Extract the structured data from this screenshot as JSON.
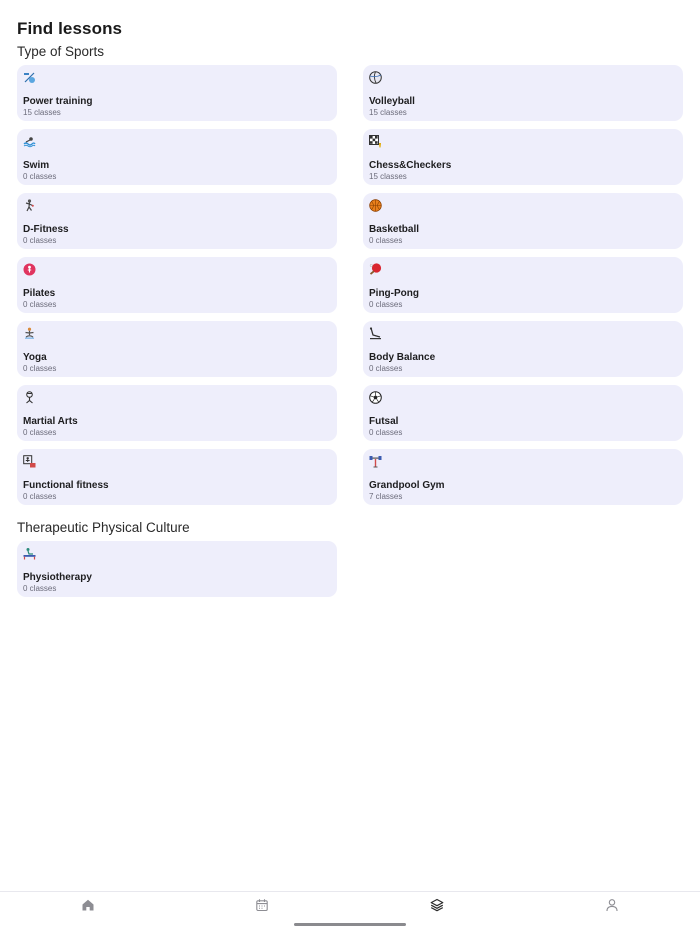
{
  "header": {
    "title": "Find lessons"
  },
  "sections": [
    {
      "title": "Type of Sports"
    },
    {
      "title": "Therapeutic Physical Culture"
    }
  ],
  "sports": [
    {
      "name": "Power training",
      "classes": "15 classes",
      "icon": "dumbbell-ball-icon"
    },
    {
      "name": "Volleyball",
      "classes": "15 classes",
      "icon": "volleyball-icon"
    },
    {
      "name": "Swim",
      "classes": "0 classes",
      "icon": "swimmer-icon"
    },
    {
      "name": "Chess&Checkers",
      "classes": "15 classes",
      "icon": "chess-board-icon"
    },
    {
      "name": "D-Fitness",
      "classes": "0 classes",
      "icon": "dancer-icon"
    },
    {
      "name": "Basketball",
      "classes": "0 classes",
      "icon": "basketball-icon"
    },
    {
      "name": "Pilates",
      "classes": "0 classes",
      "icon": "pilates-ball-icon"
    },
    {
      "name": "Ping-Pong",
      "classes": "0 classes",
      "icon": "ping-pong-paddle-icon"
    },
    {
      "name": "Yoga",
      "classes": "0 classes",
      "icon": "yoga-pose-icon"
    },
    {
      "name": "Body Balance",
      "classes": "0 classes",
      "icon": "balance-icon"
    },
    {
      "name": "Martial Arts",
      "classes": "0 classes",
      "icon": "martial-arts-icon"
    },
    {
      "name": "Futsal",
      "classes": "0 classes",
      "icon": "soccer-ball-icon"
    },
    {
      "name": "Functional fitness",
      "classes": "0 classes",
      "icon": "functional-training-icon"
    },
    {
      "name": "Grandpool Gym",
      "classes": "7 classes",
      "icon": "gym-dumbbell-icon"
    }
  ],
  "therapeutic": [
    {
      "name": "Physiotherapy",
      "classes": "0 classes",
      "icon": "rehab-bed-icon"
    }
  ],
  "tabbar": {
    "items": [
      {
        "icon": "home-icon",
        "active": false
      },
      {
        "icon": "calendar-icon",
        "active": false
      },
      {
        "icon": "layers-icon",
        "active": true
      },
      {
        "icon": "profile-icon",
        "active": false
      }
    ]
  },
  "colors": {
    "card_background": "#eeeefb",
    "tab_active": "#2b2b2b",
    "tab_inactive": "#8d8d93"
  }
}
